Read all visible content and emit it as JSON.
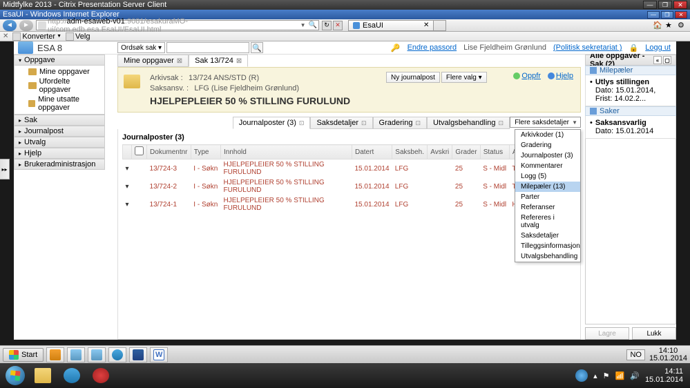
{
  "outer_window": {
    "title": "Midtfylke 2013 - Citrix Presentation Server Client"
  },
  "ie_window": {
    "title": "EsaUI - Windows Internet Explorer"
  },
  "ie_nav": {
    "url_prefix": "http://",
    "url_host": "adm-esaweb-v01",
    "url_rest": ":9081/esakuraMO-ui/com.edb.esa.EsaUI/EsaUI.html",
    "tab_label": "EsaUI"
  },
  "ie_toolbar": {
    "konverter": "Konverter",
    "velg": "Velg"
  },
  "app": {
    "name": "ESA 8",
    "search_type": "Ordsøk sak ▾",
    "user_links": {
      "endre_passord": "Endre passord",
      "user_name": "Lise Fjeldheim Grønlund",
      "politisk": "(Politisk sekretariat )",
      "logg_ut": "Logg ut"
    }
  },
  "sidebar": {
    "sections": [
      {
        "label": "Oppgave",
        "open": true
      },
      {
        "label": "Sak"
      },
      {
        "label": "Journalpost"
      },
      {
        "label": "Utvalg"
      },
      {
        "label": "Hjelp"
      },
      {
        "label": "Brukeradministrasjon"
      }
    ],
    "oppgave_items": [
      {
        "label": "Mine oppgaver"
      },
      {
        "label": "Ufordelte oppgaver"
      },
      {
        "label": "Mine utsatte oppgaver"
      }
    ]
  },
  "center_tabs": [
    {
      "label": "Mine oppgaver",
      "active": false
    },
    {
      "label": "Sak 13/724",
      "active": true
    }
  ],
  "case": {
    "arkivsak_label": "Arkivsak :",
    "arkivsak_value": "13/724 ANS/STD (R)",
    "saksansv_label": "Saksansv. :",
    "saksansv_value": "LFG (Lise Fjeldheim Grønlund)",
    "title": "HJELPEPLEIER 50 % STILLING FURULUND",
    "btn_ny": "Ny journalpost",
    "btn_flere": "Flere valg ▾",
    "link_oppfr": "Oppfr",
    "link_hjelp": "Hjelp"
  },
  "sub_tabs": [
    {
      "label": "Journalposter (3)",
      "active": true
    },
    {
      "label": "Saksdetaljer"
    },
    {
      "label": "Gradering"
    },
    {
      "label": "Utvalgsbehandling"
    }
  ],
  "flere_saksdetaljer": "Flere saksdetaljer",
  "dropdown": [
    {
      "label": "Arkivkoder (1)"
    },
    {
      "label": "Gradering"
    },
    {
      "label": "Journalposter (3)"
    },
    {
      "label": "Kommentarer"
    },
    {
      "label": "Logg (5)"
    },
    {
      "label": "Milepæler (13)",
      "highlight": true
    },
    {
      "label": "Parter"
    },
    {
      "label": "Referanser"
    },
    {
      "label": "Refereres i utvalg"
    },
    {
      "label": "Saksdetaljer"
    },
    {
      "label": "Tilleggsinformasjon"
    },
    {
      "label": "Utvalgsbehandling"
    }
  ],
  "journal": {
    "title": "Journalposter (3)",
    "columns": [
      "",
      "",
      "Dokumentnr",
      "Type",
      "Innhold",
      "Datert",
      "Saksbeh.",
      "Avskri",
      "Grader",
      "Status",
      "Adressebeskrivelse"
    ],
    "rows": [
      {
        "doknr": "13/724-3",
        "type": "I - Søkn",
        "innhold": "HJELPEPLEIER 50 % STILLING FURULUND",
        "datert": "15.01.2014",
        "saksbeh": "LFG",
        "avskri": "",
        "grader": "25",
        "status": "S - Midl",
        "adresse": "Tom Tomsen"
      },
      {
        "doknr": "13/724-2",
        "type": "I - Søkn",
        "innhold": "HJELPEPLEIER 50 % STILLING FURULUND",
        "datert": "15.01.2014",
        "saksbeh": "LFG",
        "avskri": "",
        "grader": "25",
        "status": "S - Midl",
        "adresse": "Titten Tei"
      },
      {
        "doknr": "13/724-1",
        "type": "I - Søkn",
        "innhold": "HJELPEPLEIER 50 % STILLING FURULUND",
        "datert": "15.01.2014",
        "saksbeh": "LFG",
        "avskri": "",
        "grader": "25",
        "status": "S - Midl",
        "adresse": "Hei Heisen"
      }
    ]
  },
  "right_panel": {
    "title": "Alle oppgaver - Sak (2)",
    "section_milepaeler": "Milepæler",
    "task1": {
      "name": "Utlys stillingen",
      "detail": "Dato: 15.01.2014, Frist: 14.02.2..."
    },
    "section_saker": "Saker",
    "task2": {
      "name": "Saksansvarlig",
      "detail": "Dato: 15.01.2014"
    },
    "btn_lagre": "Lagre",
    "btn_lukk": "Lukk"
  },
  "inner_taskbar": {
    "start": "Start",
    "lang": "NO",
    "time": "14:10",
    "date": "15.01.2014"
  },
  "outer_taskbar": {
    "time": "14:11",
    "date": "15.01.2014"
  }
}
